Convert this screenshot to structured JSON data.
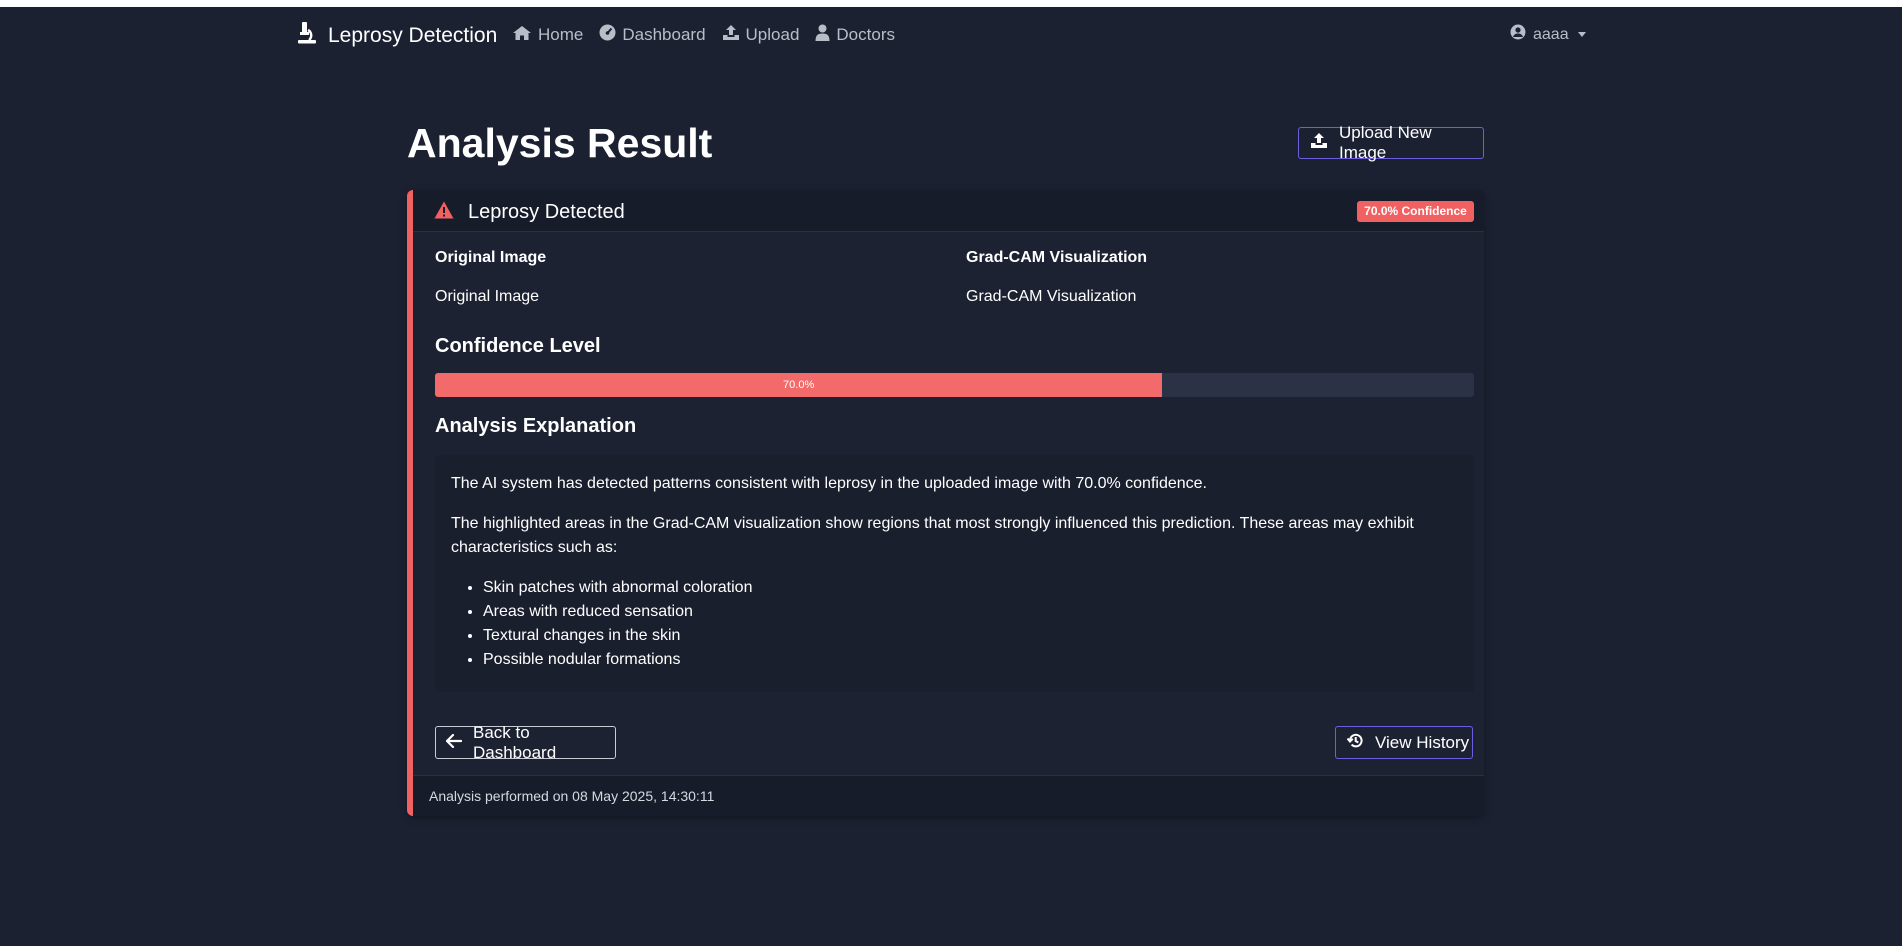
{
  "navbar": {
    "brand": "Leprosy Detection",
    "links": [
      {
        "label": "Home",
        "icon": "home-icon"
      },
      {
        "label": "Dashboard",
        "icon": "dashboard-icon"
      },
      {
        "label": "Upload",
        "icon": "upload-icon"
      },
      {
        "label": "Doctors",
        "icon": "doctor-icon"
      }
    ],
    "user": "aaaa"
  },
  "header": {
    "title": "Analysis Result",
    "upload_button": "Upload New Image"
  },
  "result": {
    "status": "Leprosy Detected",
    "confidence_badge": "70.0% Confidence",
    "original_label": "Original Image",
    "original_alt": "Original Image",
    "gradcam_label": "Grad-CAM Visualization",
    "gradcam_alt": "Grad-CAM Visualization",
    "confidence_title": "Confidence Level",
    "confidence_value": 0.7,
    "confidence_text": "70.0%",
    "explanation_title": "Analysis Explanation",
    "explanation_p1": "The AI system has detected patterns consistent with leprosy in the uploaded image with 70.0% confidence.",
    "explanation_p2": "The highlighted areas in the Grad-CAM visualization show regions that most strongly influenced this prediction. These areas may exhibit characteristics such as:",
    "characteristics": [
      "Skin patches with abnormal coloration",
      "Areas with reduced sensation",
      "Textural changes in the skin",
      "Possible nodular formations"
    ],
    "back_button": "Back to Dashboard",
    "history_button": "View History",
    "footer": "Analysis performed on 08 May 2025, 14:30:11"
  },
  "colors": {
    "background": "#1c2132",
    "danger": "#f16161",
    "accent": "#6d5ee0"
  }
}
